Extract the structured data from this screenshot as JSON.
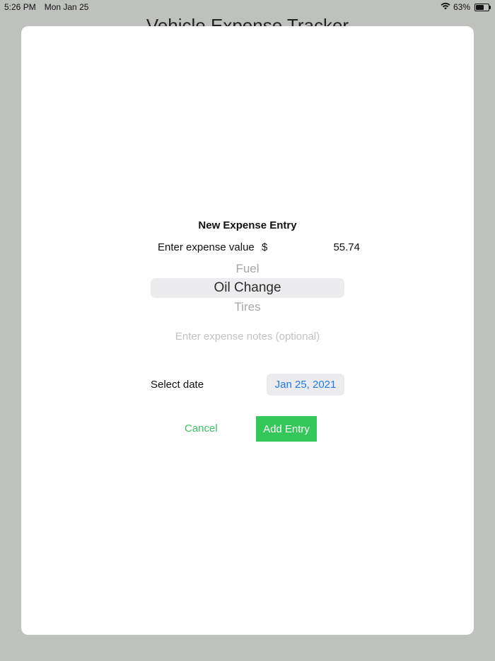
{
  "status_bar": {
    "time": "5:26 PM",
    "date": "Mon Jan 25",
    "battery": "63%",
    "battery_level": 0.63,
    "icons": [
      "wifi-icon",
      "battery-icon"
    ]
  },
  "app": {
    "title": "Vehicle Expense Tracker"
  },
  "form": {
    "title": "New Expense Entry",
    "value_label": "Enter expense value",
    "currency_symbol": "$",
    "value": "55.74",
    "picker": {
      "options": [
        "Fuel",
        "Oil Change",
        "Tires"
      ],
      "selected": "Oil Change"
    },
    "notes_placeholder": "Enter expense notes (optional)",
    "date_label": "Select date",
    "date_value": "Jan 25, 2021",
    "cancel_label": "Cancel",
    "add_label": "Add Entry"
  },
  "colors": {
    "accent_green": "#34c759",
    "link_blue": "#1f7ae8",
    "dimmed_background": "#bfc1be"
  }
}
